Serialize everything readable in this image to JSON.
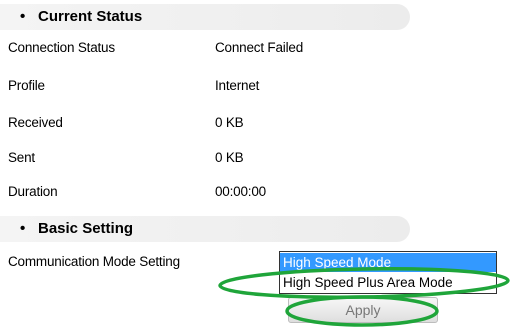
{
  "current_status": {
    "title": "Current Status",
    "rows": [
      {
        "label": "Connection Status",
        "value": "Connect Failed"
      },
      {
        "label": "Profile",
        "value": "Internet"
      },
      {
        "label": "Received",
        "value": "0 KB"
      },
      {
        "label": "Sent",
        "value": "0 KB"
      },
      {
        "label": "Duration",
        "value": "00:00:00"
      }
    ]
  },
  "basic_setting": {
    "title": "Basic Setting",
    "mode_label": "Communication Mode Setting",
    "options": [
      {
        "label": "High Speed Mode",
        "selected": true
      },
      {
        "label": "High Speed Plus Area Mode",
        "selected": false
      }
    ],
    "apply_label": "Apply"
  },
  "colors": {
    "selected_option_bg": "#3399ff",
    "annotation_ellipse": "#1fa53a"
  }
}
